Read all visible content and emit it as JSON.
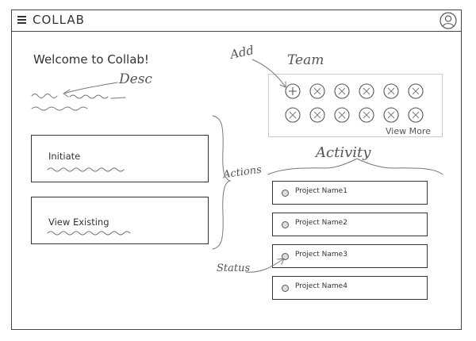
{
  "header": {
    "title": "COLLAB"
  },
  "welcome": {
    "title": "Welcome to Collab!"
  },
  "annotations": {
    "desc": "Desc",
    "add": "Add",
    "team": "Team",
    "actions": "Actions",
    "activity": "Activity",
    "status": "Status"
  },
  "actions": [
    {
      "label": "Initiate"
    },
    {
      "label": "View Existing"
    }
  ],
  "team": {
    "view_more": "View More"
  },
  "projects": [
    {
      "name": "Project Name1"
    },
    {
      "name": "Project Name2"
    },
    {
      "name": "Project Name3"
    },
    {
      "name": "Project Name4"
    }
  ]
}
